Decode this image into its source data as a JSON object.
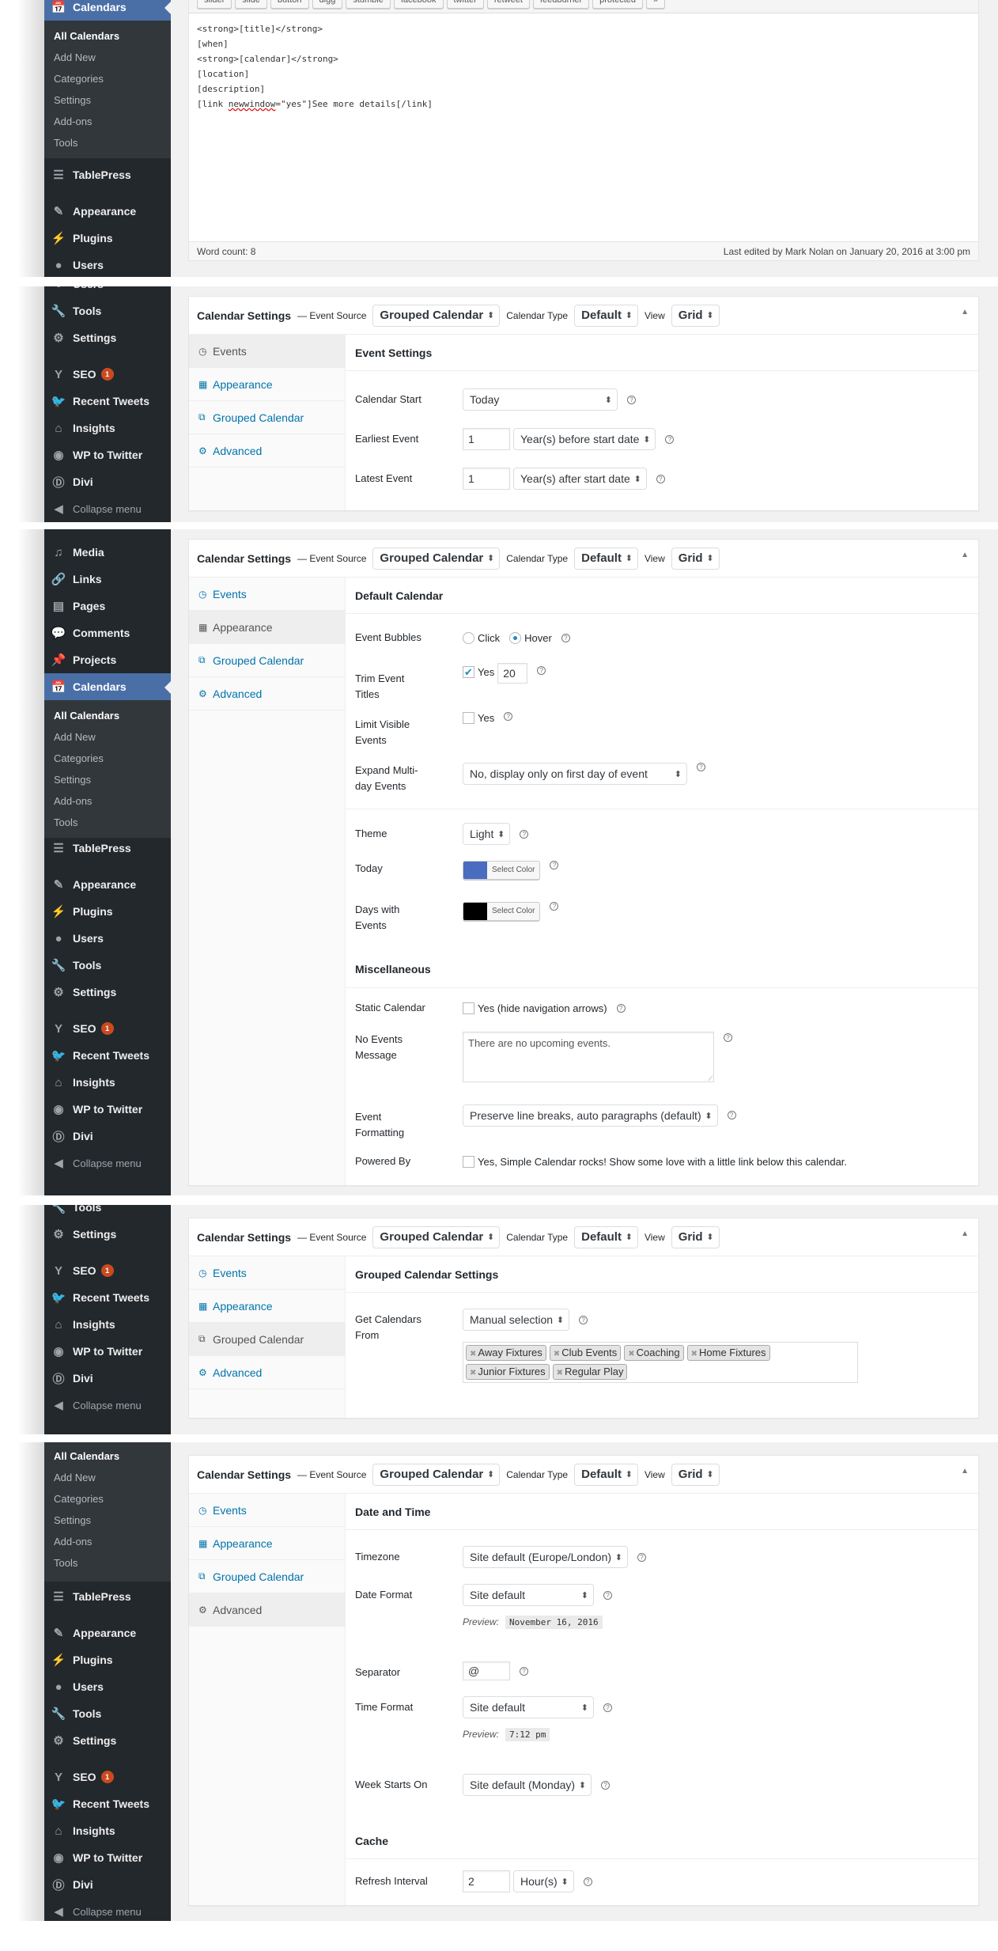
{
  "admin_menu": {
    "calendars": "Calendars",
    "calendars_sub": [
      "All Calendars",
      "Add New",
      "Categories",
      "Settings",
      "Add-ons",
      "Tools"
    ],
    "tablepress": "TablePress",
    "appearance": "Appearance",
    "plugins": "Plugins",
    "users": "Users",
    "tools": "Tools",
    "settings": "Settings",
    "seo": "SEO",
    "seo_badge": "1",
    "recent_tweets": "Recent Tweets",
    "insights": "Insights",
    "wp_to_twitter": "WP to Twitter",
    "divi": "Divi",
    "collapse": "Collapse menu",
    "media": "Media",
    "links": "Links",
    "pages": "Pages",
    "comments": "Comments",
    "projects": "Projects"
  },
  "editor": {
    "toolbar": [
      "slider",
      "slide",
      "button",
      "digg",
      "stumble",
      "facebook",
      "twitter",
      "retweet",
      "feedburner",
      "protected",
      "»"
    ],
    "lines": [
      "<strong>[title]</strong>",
      "[when]",
      "<strong>[calendar]</strong>",
      "[location]",
      "[description]"
    ],
    "last_line_pre": "[link ",
    "last_line_spell": "newwindow",
    "last_line_post": "=\"yes\"]See more details[/link]",
    "word_count": "Word count: 8",
    "last_edited": "Last edited by Mark Nolan on January 20, 2016 at 3:00 pm"
  },
  "settings_header": {
    "title": "Calendar Settings",
    "event_source_label": "— Event Source",
    "event_source": "Grouped Calendar",
    "calendar_type_label": "Calendar Type",
    "calendar_type": "Default",
    "view_label": "View",
    "view": "Grid",
    "toggle": "▲"
  },
  "tabs": {
    "events": "Events",
    "appearance": "Appearance",
    "grouped": "Grouped Calendar",
    "advanced": "Advanced"
  },
  "events_panel": {
    "title": "Event Settings",
    "calendar_start_label": "Calendar Start",
    "calendar_start": "Today",
    "earliest_label": "Earliest Event",
    "earliest_value": "1",
    "earliest_unit": "Year(s) before start date",
    "latest_label": "Latest Event",
    "latest_value": "1",
    "latest_unit": "Year(s) after start date"
  },
  "appearance_panel": {
    "title": "Default Calendar",
    "bubbles_label": "Event Bubbles",
    "bubbles_click": "Click",
    "bubbles_hover": "Hover",
    "bubbles_selected": "Hover",
    "trim_label": "Trim Event Titles",
    "trim_checked": true,
    "trim_yes": "Yes",
    "trim_value": "20",
    "limit_label": "Limit Visible Events",
    "limit_checked": false,
    "limit_yes": "Yes",
    "expand_label": "Expand Multi-day Events",
    "expand_value": "No, display only on first day of event",
    "theme_label": "Theme",
    "theme_value": "Light",
    "today_label": "Today",
    "today_color": "#4a6cc0",
    "days_label": "Days with Events",
    "days_color": "#000000",
    "select_color": "Select Color",
    "misc_title": "Miscellaneous",
    "static_label": "Static Calendar",
    "static_text": "Yes (hide navigation arrows)",
    "no_events_label": "No Events Message",
    "no_events_value": "There are no upcoming events.",
    "formatting_label": "Event Formatting",
    "formatting_value": "Preserve line breaks, auto paragraphs (default)",
    "powered_label": "Powered By",
    "powered_text": "Yes, Simple Calendar rocks! Show some love with a little link below this calendar."
  },
  "grouped_panel": {
    "title": "Grouped Calendar Settings",
    "get_label": "Get Calendars From",
    "get_value": "Manual selection",
    "tags": [
      "Away Fixtures",
      "Club Events",
      "Coaching",
      "Home Fixtures",
      "Junior Fixtures",
      "Regular Play"
    ]
  },
  "advanced_panel": {
    "title": "Date and Time",
    "timezone_label": "Timezone",
    "timezone_value": "Site default (Europe/London)",
    "date_format_label": "Date Format",
    "date_format_value": "Site default",
    "preview_label": "Preview:",
    "date_preview": "November 16, 2016",
    "separator_label": "Separator",
    "separator_value": "@",
    "time_format_label": "Time Format",
    "time_format_value": "Site default",
    "time_preview": "7:12 pm",
    "week_label": "Week Starts On",
    "week_value": "Site default (Monday)",
    "cache_title": "Cache",
    "refresh_label": "Refresh Interval",
    "refresh_value": "2",
    "refresh_unit": "Hour(s)"
  },
  "help_glyph": "?"
}
